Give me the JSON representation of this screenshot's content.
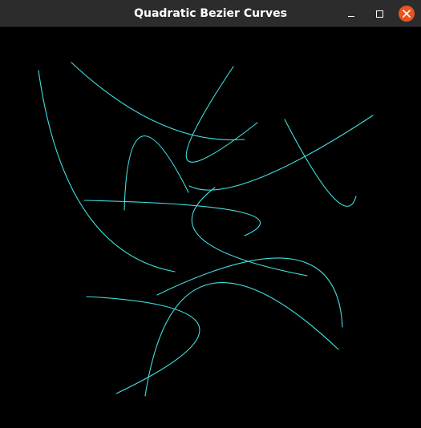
{
  "window": {
    "title": "Quadratic Bezier Curves"
  },
  "titlebar_controls": {
    "minimize_icon": "minimize-icon",
    "maximize_icon": "maximize-icon",
    "close_icon": "close-icon"
  },
  "colors": {
    "titlebar_bg": "#2c2c2c",
    "close_button": "#e95420",
    "canvas_bg": "#000000",
    "curve_stroke": "#40e0e0"
  }
}
